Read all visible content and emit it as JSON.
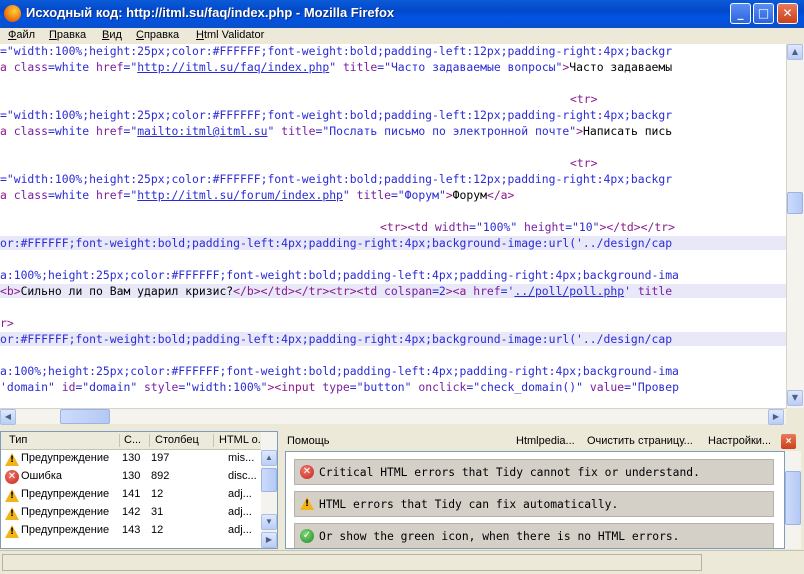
{
  "window": {
    "title": "Исходный код: http://itml.su/faq/index.php - Mozilla Firefox",
    "minimize": "_",
    "maximize": "□",
    "close": "✕"
  },
  "menu": [
    "Файл",
    "Правка",
    "Вид",
    "Справка",
    "Html Validator"
  ],
  "source": {
    "l1_a": "=\"width:100%;height:25px;color:#FFFFFF;font-weight:bold;padding-left:12px;padding-right:4px;backgr",
    "l2_tag1": "a ",
    "l2_attr1": "class",
    "l2_val1": "=white ",
    "l2_attr2": "href",
    "l2_eq": "=\"",
    "l2_link": "http://itml.su/faq/index.php",
    "l2_q": "\" ",
    "l2_attr3": "title",
    "l2_val3": "=\"Часто задаваемые вопросы\"",
    "l2_tag2": ">",
    "l2_text": "Часто задаваемы",
    "l3_tr": "<tr>",
    "l4_a": "=\"width:100%;height:25px;color:#FFFFFF;font-weight:bold;padding-left:12px;padding-right:4px;backgr",
    "l5_tag1": "a ",
    "l5_attr1": "class",
    "l5_val1": "=white ",
    "l5_attr2": "href",
    "l5_eq": "=\"",
    "l5_link": "mailto:itml@itml.su",
    "l5_q": "\" ",
    "l5_attr3": "title",
    "l5_val3": "=\"Послать письмо по электронной почте\"",
    "l5_tag2": ">",
    "l5_text": "Написать пись",
    "l6_tr": "<tr>",
    "l7_a": "=\"width:100%;height:25px;color:#FFFFFF;font-weight:bold;padding-left:12px;padding-right:4px;backgr",
    "l8_tag1": "a ",
    "l8_attr1": "class",
    "l8_val1": "=white ",
    "l8_attr2": "href",
    "l8_eq": "=\"",
    "l8_link": "http://itml.su/forum/index.php",
    "l8_q": "\" ",
    "l8_attr3": "title",
    "l8_val3": "=\"Форум\"",
    "l8_tag2": ">",
    "l8_text": "Форум",
    "l8_tag3": "</a>",
    "l9_a": "<tr><td ",
    "l9_b": "width",
    "l9_c": "=\"100%\" ",
    "l9_d": "height",
    "l9_e": "=\"10\"",
    "l9_f": "></td></tr>",
    "l10": "or:#FFFFFF;font-weight:bold;padding-left:4px;padding-right:4px;background-image:url('../design/cap",
    "l11": "a:100%;height:25px;color:#FFFFFF;font-weight:bold;padding-left:4px;padding-right:4px;background-ima",
    "l12_tag1": "<b>",
    "l12_text": "Сильно ли по Вам ударил кризис?",
    "l12_tag2": "</b></td></tr><tr><td ",
    "l12_attr": "colspan",
    "l12_val": "=2",
    "l12_tag3": "><a ",
    "l12_attr2": "href",
    "l12_eq": "='",
    "l12_link": "../poll/poll.php",
    "l12_q": "' ",
    "l12_attr3": "title",
    "l13": "r>",
    "l14": "or:#FFFFFF;font-weight:bold;padding-left:4px;padding-right:4px;background-image:url('../design/cap",
    "l15": "a:100%;height:25px;color:#FFFFFF;font-weight:bold;padding-left:4px;padding-right:4px;background-ima",
    "l16_a": "'domain\" ",
    "l16_b": "id",
    "l16_c": "=\"domain\" ",
    "l16_d": "style",
    "l16_e": "=\"width:100%\"",
    "l16_f": "><input ",
    "l16_g": "type",
    "l16_h": "=\"button\" ",
    "l16_i": "onclick",
    "l16_j": "=\"check_domain()\" ",
    "l16_k": "value",
    "l16_l": "=\"Провер"
  },
  "errors": {
    "columns": [
      "Тип",
      "С...",
      "Столбец",
      "HTML о..."
    ],
    "rows": [
      {
        "type": "Предупреждение",
        "line": "130",
        "col": "197",
        "desc": "mis..."
      },
      {
        "type": "Ошибка",
        "line": "130",
        "col": "892",
        "desc": "disc..."
      },
      {
        "type": "Предупреждение",
        "line": "141",
        "col": "12",
        "desc": "adj..."
      },
      {
        "type": "Предупреждение",
        "line": "142",
        "col": "31",
        "desc": "adj..."
      },
      {
        "type": "Предупреждение",
        "line": "143",
        "col": "12",
        "desc": "adj..."
      }
    ]
  },
  "help": {
    "title": "Помощь",
    "htmlpedia": "Htmlpedia...",
    "clear": "Очистить страницу...",
    "settings": "Настройки...",
    "close": "×",
    "items": [
      "Critical HTML errors that Tidy cannot fix or understand.",
      "HTML errors that Tidy can fix automatically.",
      "Or show the green icon, when there is no HTML errors."
    ]
  },
  "icons": {
    "warning": "!",
    "error": "✕",
    "ok": "✓"
  }
}
